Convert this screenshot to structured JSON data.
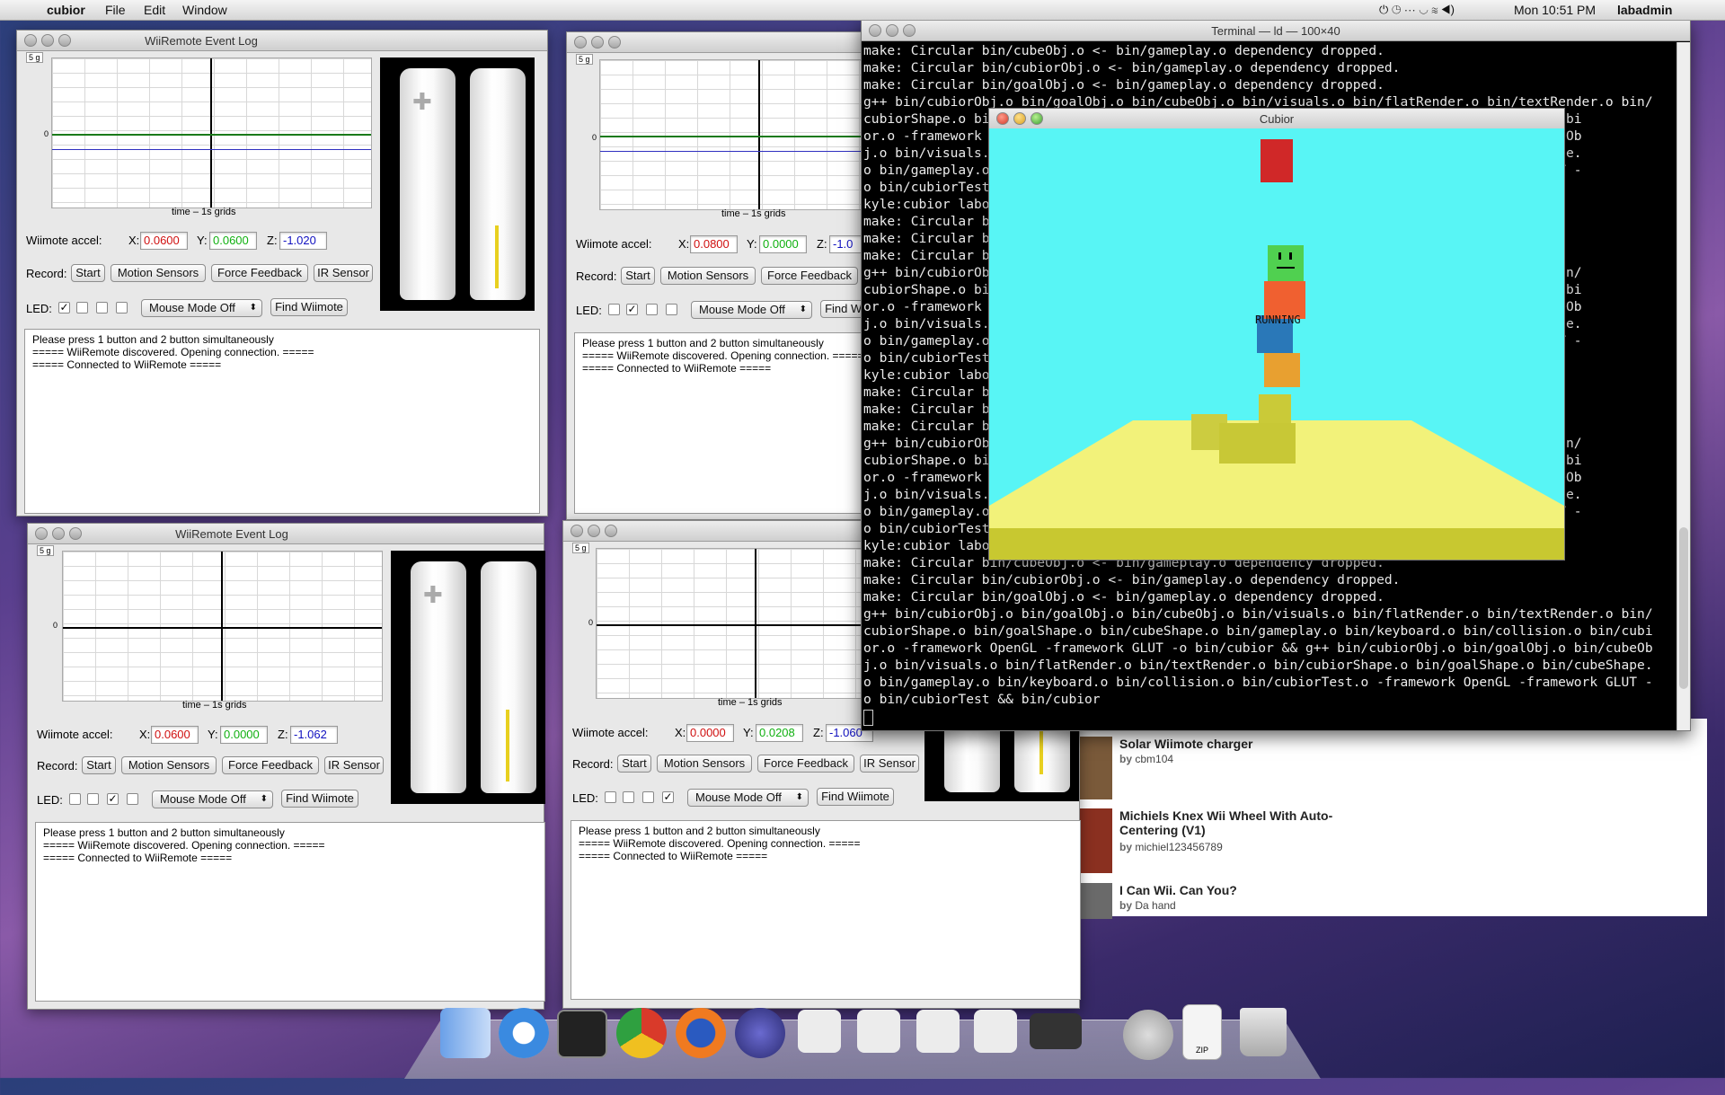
{
  "menubar": {
    "app_name": "cubior",
    "menus": [
      "File",
      "Edit",
      "Window"
    ],
    "clock": "Mon 10:51 PM",
    "user": "labadmin"
  },
  "wii_common": {
    "window_title": "WiiRemote Event Log",
    "scale": "5 g",
    "zero": "0",
    "grid_label": "time – 1s grids",
    "accel_label": "Wiimote accel:",
    "x_label": "X:",
    "y_label": "Y:",
    "z_label": "Z:",
    "record_label": "Record:",
    "start": "Start",
    "motion": "Motion Sensors",
    "force": "Force Feedback",
    "ir": "IR Sensor",
    "led_label": "LED:",
    "mouse_mode": "Mouse Mode Off",
    "find": "Find Wiimote",
    "log_lines": [
      "Please press 1 button and 2 button simultaneously",
      "===== WiiRemote discovered.  Opening connection. =====",
      "===== Connected to WiiRemote ====="
    ]
  },
  "windows": [
    {
      "x": "0.0600",
      "y": "0.0600",
      "z": "-1.020",
      "leds": [
        "✓",
        "",
        "",
        ""
      ]
    },
    {
      "x": "0.0800",
      "y": "0.0000",
      "z": "-1.0",
      "leds": [
        "",
        "✓",
        "",
        ""
      ]
    },
    {
      "x": "0.0600",
      "y": "0.0000",
      "z": "-1.062",
      "leds": [
        "",
        "",
        "✓",
        ""
      ]
    },
    {
      "x": "0.0000",
      "y": "0.0208",
      "z": "-1.060",
      "leds": [
        "",
        "",
        "",
        "✓"
      ]
    }
  ],
  "terminal": {
    "title": "Terminal — ld — 100×40",
    "lines": [
      "make: Circular bin/cubeObj.o <- bin/gameplay.o dependency dropped.",
      "make: Circular bin/cubiorObj.o <- bin/gameplay.o dependency dropped.",
      "make: Circular bin/goalObj.o <- bin/gameplay.o dependency dropped.",
      "g++ bin/cubiorObj.o bin/goalObj.o bin/cubeObj.o bin/visuals.o bin/flatRender.o bin/textRender.o bin/",
      "cubiorShape.o bi                                                              on.o bin/cubi",
      "or.o -framework                                                               .o bin/cubeOb",
      "j.o bin/visuals.                                                              in/cubeShape.",
      "o bin/gameplay.o                                                              mework GLUT -",
      "o bin/cubiorTest",
      "kyle:cubior labo",
      "make: Circular b",
      "make: Circular b",
      "make: Circular b",
      "g++ bin/cubiorOb                                                              Render.o bin/",
      "cubiorShape.o bi                                                              on.o bin/cubi",
      "or.o -framework                                                               .o bin/cubeOb",
      "j.o bin/visuals.                                                              in/cubeShape.",
      "o bin/gameplay.o                                                              mework GLUT -",
      "o bin/cubiorTest",
      "kyle:cubior labo",
      "make: Circular b",
      "make: Circular b",
      "make: Circular b",
      "g++ bin/cubiorOb                                                              Render.o bin/",
      "cubiorShape.o bi                                                              on.o bin/cubi",
      "or.o -framework                                                               .o bin/cubeOb",
      "j.o bin/visuals.                                                              in/cubeShape.",
      "o bin/gameplay.o                                                              mework GLUT -",
      "o bin/cubiorTest",
      "kyle:cubior labo",
      "make: Circular bin/cubeObj.o <- bin/gameplay.o dependency dropped.",
      "make: Circular bin/cubiorObj.o <- bin/gameplay.o dependency dropped.",
      "make: Circular bin/goalObj.o <- bin/gameplay.o dependency dropped.",
      "g++ bin/cubiorObj.o bin/goalObj.o bin/cubeObj.o bin/visuals.o bin/flatRender.o bin/textRender.o bin/",
      "cubiorShape.o bin/goalShape.o bin/cubeShape.o bin/gameplay.o bin/keyboard.o bin/collision.o bin/cubi",
      "or.o -framework OpenGL -framework GLUT -o bin/cubior && g++ bin/cubiorObj.o bin/goalObj.o bin/cubeOb",
      "j.o bin/visuals.o bin/flatRender.o bin/textRender.o bin/cubiorShape.o bin/goalShape.o bin/cubeShape.",
      "o bin/gameplay.o bin/keyboard.o bin/collision.o bin/cubiorTest.o -framework OpenGL -framework GLUT -",
      "o bin/cubiorTest && bin/cubior"
    ]
  },
  "cubior": {
    "title": "Cubior",
    "status": "RUNNING"
  },
  "webpage": {
    "items": [
      {
        "title": "Solar Wiimote charger",
        "by": "by",
        "author": "cbm104"
      },
      {
        "title": "Michiels Knex Wii Wheel With Auto-Centering (V1)",
        "by": "by",
        "author": "michiel123456789"
      },
      {
        "title": "I Can Wii. Can You?",
        "by": "by",
        "author": "Da hand"
      }
    ]
  },
  "dock": {
    "zip_label": "ZIP"
  },
  "colors": {
    "sky": "#58f5f5",
    "ground": "#f2f27a"
  }
}
